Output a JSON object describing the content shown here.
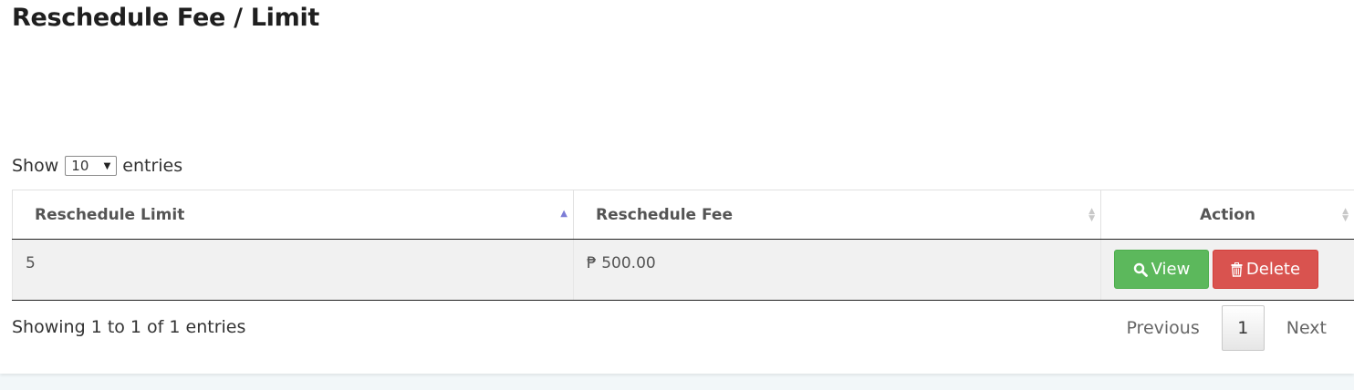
{
  "page": {
    "title": "Reschedule Fee / Limit"
  },
  "length_menu": {
    "show_label": "Show",
    "selected": "10",
    "entries_label": "entries"
  },
  "table": {
    "columns": [
      "Reschedule Limit",
      "Reschedule Fee",
      "Action"
    ],
    "rows": [
      {
        "limit": "5",
        "fee": "₱ 500.00",
        "view_label": "View",
        "delete_label": "Delete"
      }
    ]
  },
  "info": "Showing 1 to 1 of 1 entries",
  "pagination": {
    "previous": "Previous",
    "current": "1",
    "next": "Next"
  },
  "icons": {
    "view": "search-icon",
    "delete": "trash-icon"
  },
  "colors": {
    "view_button": "#5cb85c",
    "delete_button": "#d9534f",
    "sort_active": "#7d7dd6"
  }
}
